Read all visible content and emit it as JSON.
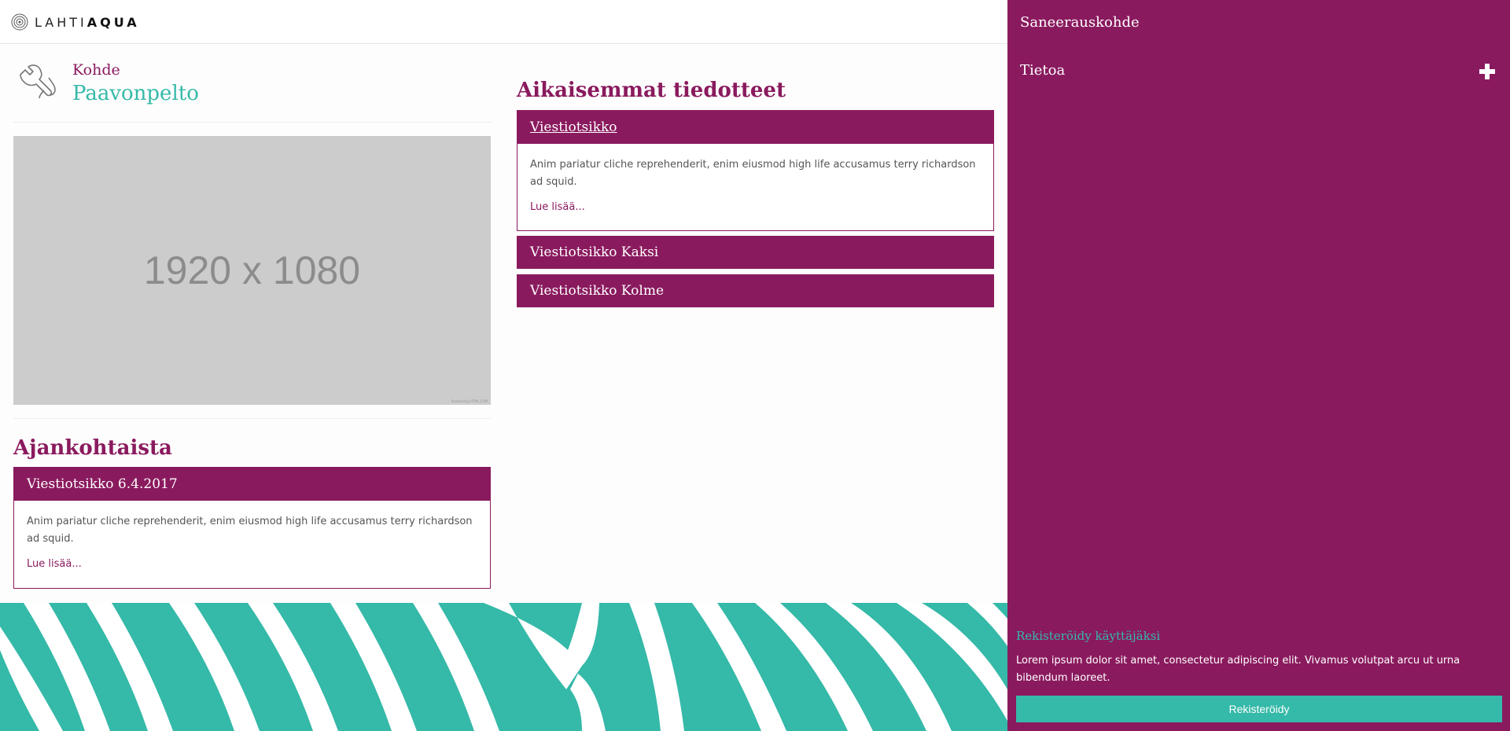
{
  "header": {
    "logo_light": "LAHTI",
    "logo_bold": "AQUA"
  },
  "kohde": {
    "label": "Kohde",
    "name": "Paavonpelto"
  },
  "image_placeholder": {
    "text": "1920 x 1080",
    "note": "Powered by HTML.COM"
  },
  "ajankohtaista": {
    "heading": "Ajankohtaista",
    "card": {
      "title": "Viestiotsikko 6.4.2017",
      "body": "Anim pariatur cliche reprehenderit, enim eiusmod high life accusamus terry richardson ad squid.",
      "more": "Lue lisää..."
    }
  },
  "aikaisemmat": {
    "heading": "Aikaisemmat tiedotteet",
    "items": [
      {
        "title": "Viestiotsikko",
        "body": "Anim pariatur cliche reprehenderit, enim eiusmod high life accusamus terry richardson ad squid.",
        "more": "Lue lisää..."
      },
      {
        "title": "Viestiotsikko Kaksi"
      },
      {
        "title": "Viestiotsikko Kolme"
      }
    ]
  },
  "sidebar": {
    "title": "Saneerauskohde",
    "section": "Tietoa",
    "register": {
      "title": "Rekisteröidy käyttäjäksi",
      "text": "Lorem ipsum dolor sit amet, consectetur adipiscing elit. Vivamus volutpat arcu ut urna bibendum laoreet.",
      "button": "Rekisteröidy"
    }
  },
  "colors": {
    "brand": "#8a1a5e",
    "accent": "#35b9a8",
    "placeholder": "#cccccc"
  },
  "icons": {
    "logo": "concentric-circles-icon",
    "kohde": "wrench-drop-icon",
    "expand": "plus-icon"
  }
}
